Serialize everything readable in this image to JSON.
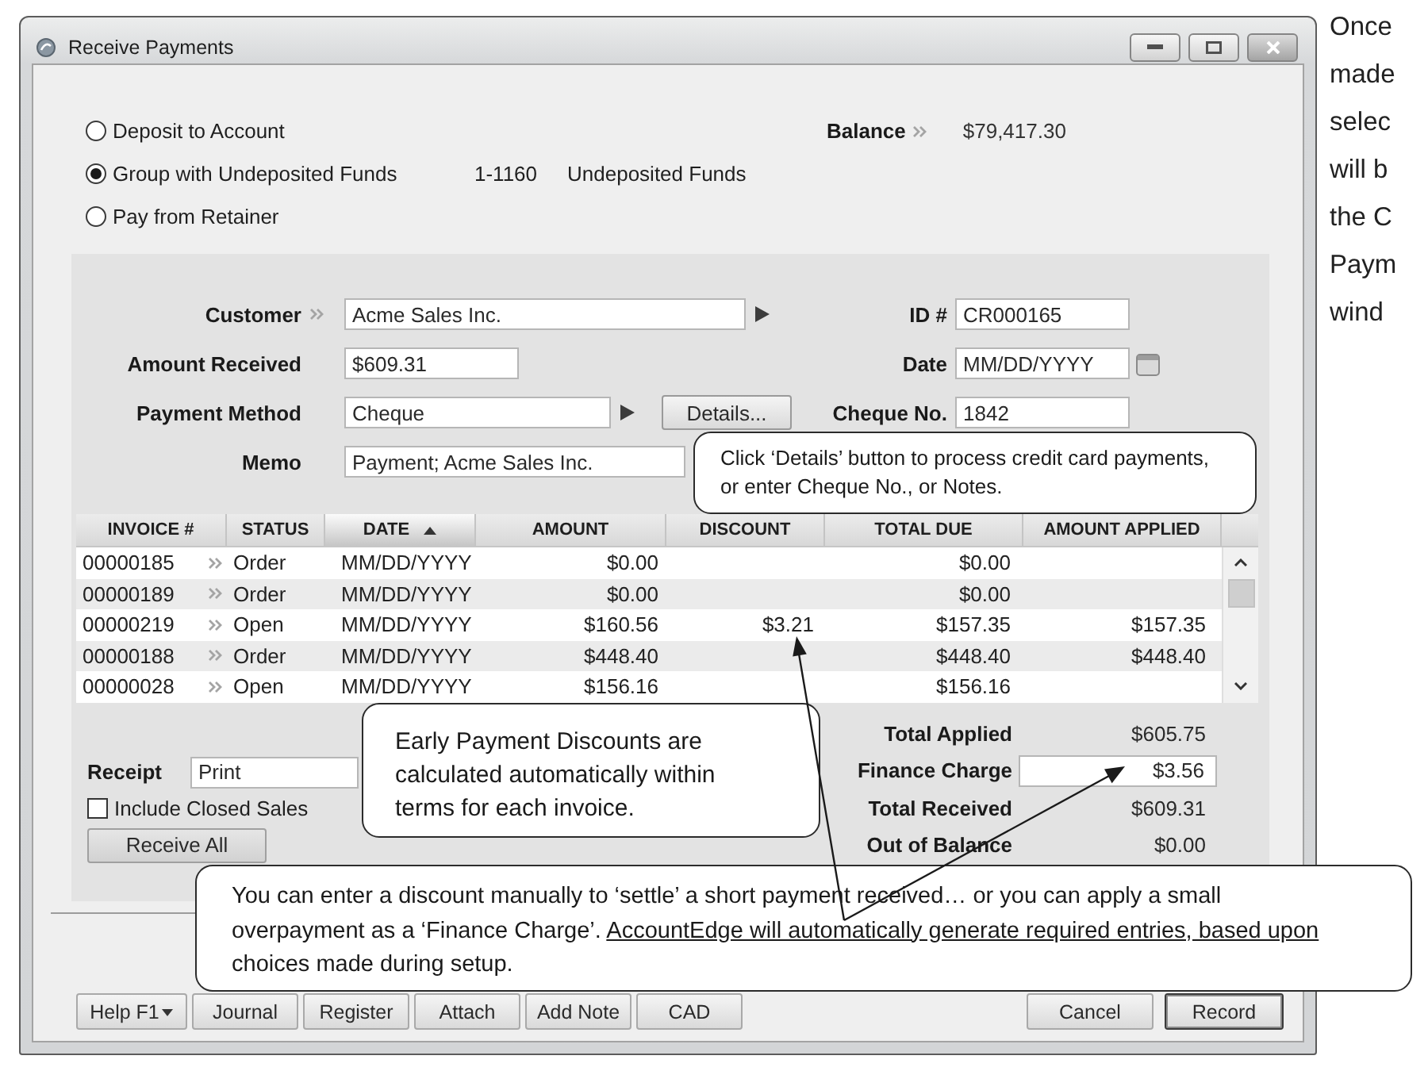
{
  "window": {
    "title": "Receive Payments"
  },
  "deposit_options": [
    {
      "label": "Deposit to Account",
      "selected": false
    },
    {
      "label": "Group with Undeposited Funds",
      "selected": true
    },
    {
      "label": "Pay from Retainer",
      "selected": false
    }
  ],
  "account": {
    "number": "1-1160",
    "name": "Undeposited Funds"
  },
  "balance": {
    "label": "Balance",
    "value": "$79,417.30"
  },
  "form": {
    "customer": {
      "label": "Customer",
      "value": "Acme Sales Inc."
    },
    "id": {
      "label": "ID #",
      "value": "CR000165"
    },
    "amount_received": {
      "label": "Amount Received",
      "value": "$609.31"
    },
    "date": {
      "label": "Date",
      "value": "MM/DD/YYYY"
    },
    "payment_method": {
      "label": "Payment Method",
      "value": "Cheque"
    },
    "details_button": "Details...",
    "cheque_no": {
      "label": "Cheque No.",
      "value": "1842"
    },
    "memo": {
      "label": "Memo",
      "value": "Payment; Acme Sales Inc."
    }
  },
  "table": {
    "columns": [
      {
        "label": "INVOICE #",
        "sorted": false
      },
      {
        "label": "STATUS",
        "sorted": false
      },
      {
        "label": "DATE",
        "sorted": true
      },
      {
        "label": "AMOUNT",
        "sorted": false
      },
      {
        "label": "DISCOUNT",
        "sorted": false
      },
      {
        "label": "TOTAL DUE",
        "sorted": false
      },
      {
        "label": "AMOUNT APPLIED",
        "sorted": false
      }
    ],
    "rows": [
      {
        "invoice": "00000185",
        "status": "Order",
        "date": "MM/DD/YYYY",
        "amount": "$0.00",
        "total_due": "$0.00"
      },
      {
        "invoice": "00000189",
        "status": "Order",
        "date": "MM/DD/YYYY",
        "amount": "$0.00",
        "total_due": "$0.00"
      },
      {
        "invoice": "00000219",
        "status": "Open",
        "date": "MM/DD/YYYY",
        "amount": "$160.56",
        "discount": "$3.21",
        "total_due": "$157.35",
        "amount_applied": "$157.35"
      },
      {
        "invoice": "00000188",
        "status": "Order",
        "date": "MM/DD/YYYY",
        "amount": "$448.40",
        "total_due": "$448.40",
        "amount_applied": "$448.40"
      },
      {
        "invoice": "00000028",
        "status": "Open",
        "date": "MM/DD/YYYY",
        "amount": "$156.16",
        "total_due": "$156.16"
      }
    ]
  },
  "receipt": {
    "label": "Receipt",
    "value": "Print"
  },
  "include_closed_sales": {
    "label": "Include Closed Sales",
    "checked": false
  },
  "receive_all_button": "Receive All",
  "totals": [
    {
      "kind": "text",
      "label": "Total Applied",
      "value": "$605.75"
    },
    {
      "kind": "field",
      "label": "Finance Charge",
      "value": "$3.56"
    },
    {
      "kind": "text",
      "label": "Total Received",
      "value": "$609.31"
    },
    {
      "kind": "text",
      "label": "Out of Balance",
      "value": "$0.00"
    }
  ],
  "footer_buttons": [
    {
      "kind": "menu",
      "label": "Help F1"
    },
    {
      "kind": "plain",
      "label": "Journal"
    },
    {
      "kind": "plain",
      "label": "Register"
    },
    {
      "kind": "plain",
      "label": "Attach"
    },
    {
      "kind": "plain",
      "label": "Add Note"
    },
    {
      "kind": "plain",
      "label": "CAD"
    }
  ],
  "dialog_buttons": [
    {
      "label": "Cancel",
      "default": false
    },
    {
      "label": "Record",
      "default": true
    }
  ],
  "callouts": {
    "details": "Click ‘Details’ button to process credit card payments, or enter Cheque No., or Notes.",
    "discounts": "Early Payment Discounts are calculated automatically within terms for each invoice.",
    "settlement": [
      {
        "text": "You can enter a discount manually to ‘settle’ a short payment received… or you can apply a small overpayment as a ‘Finance Charge’. ",
        "underlined": false
      },
      {
        "text": "AccountEdge will automatically generate required entries, based upon",
        "underlined": true
      },
      {
        "text": " choices made during setup.",
        "underlined": false
      }
    ]
  },
  "side_note": {
    "lines": [
      "Once",
      "made",
      "selec",
      "will b",
      "the C",
      "Paym",
      "wind"
    ]
  }
}
